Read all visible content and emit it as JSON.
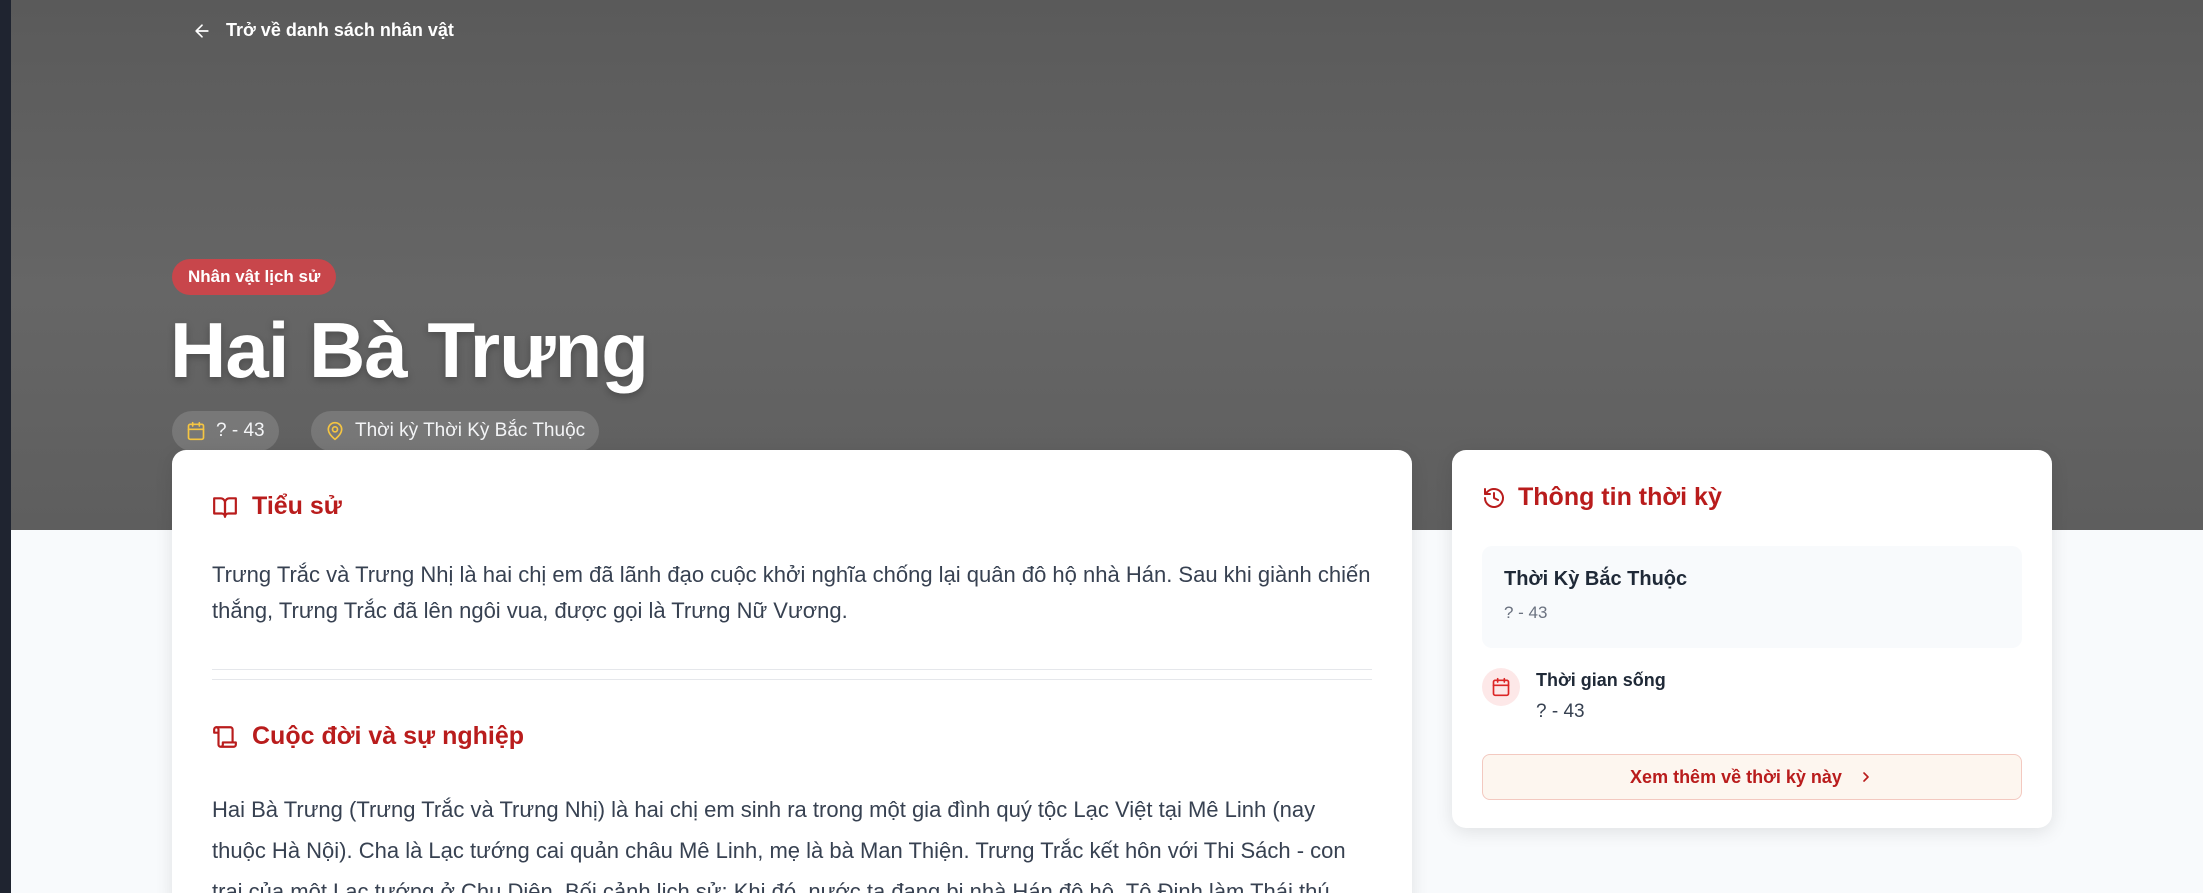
{
  "header": {
    "back_label": "Trở về danh sách nhân vật",
    "category_badge": "Nhân vật lịch sử",
    "title": "Hai Bà Trưng",
    "years_chip": "? - 43",
    "period_chip": "Thời kỳ Thời Kỳ Bắc Thuộc"
  },
  "main": {
    "biography": {
      "heading": "Tiểu sử",
      "text": "Trưng Trắc và Trưng Nhị là hai chị em đã lãnh đạo cuộc khởi nghĩa chống lại quân đô hộ nhà Hán. Sau khi giành chiến thắng, Trưng Trắc đã lên ngôi vua, được gọi là Trưng Nữ Vương."
    },
    "career": {
      "heading": "Cuộc đời và sự nghiệp",
      "text": "Hai Bà Trưng (Trưng Trắc và Trưng Nhị) là hai chị em sinh ra trong một gia đình quý tộc Lạc Việt tại Mê Linh (nay thuộc Hà Nội). Cha là Lạc tướng cai quản châu Mê Linh, mẹ là bà Man Thiện. Trưng Trắc kết hôn với Thi Sách - con trai của một Lạc tướng ở Chu Diên. Bối cảnh lịch sử: Khi đó, nước ta đang bị nhà Hán đô hộ, Tô Định làm Thái thú."
    }
  },
  "sidebar": {
    "heading": "Thông tin thời kỳ",
    "period_name": "Thời Kỳ Bắc Thuộc",
    "period_years": "? - 43",
    "lifespan_label": "Thời gian sống",
    "lifespan_value": "? - 43",
    "more_button": "Xem thêm về thời kỳ này"
  },
  "colors": {
    "accent": "#b91c1c",
    "badge": "#c8464b",
    "hero_bg": "#5f5f5f",
    "chip_icon": "#f5c542"
  },
  "icons": {
    "back": "arrow-left-icon",
    "years": "calendar-icon",
    "period": "map-pin-icon",
    "biography": "book-open-icon",
    "career": "scroll-icon",
    "sidebar": "history-icon",
    "lifespan": "calendar-icon",
    "more": "chevron-right-icon"
  }
}
